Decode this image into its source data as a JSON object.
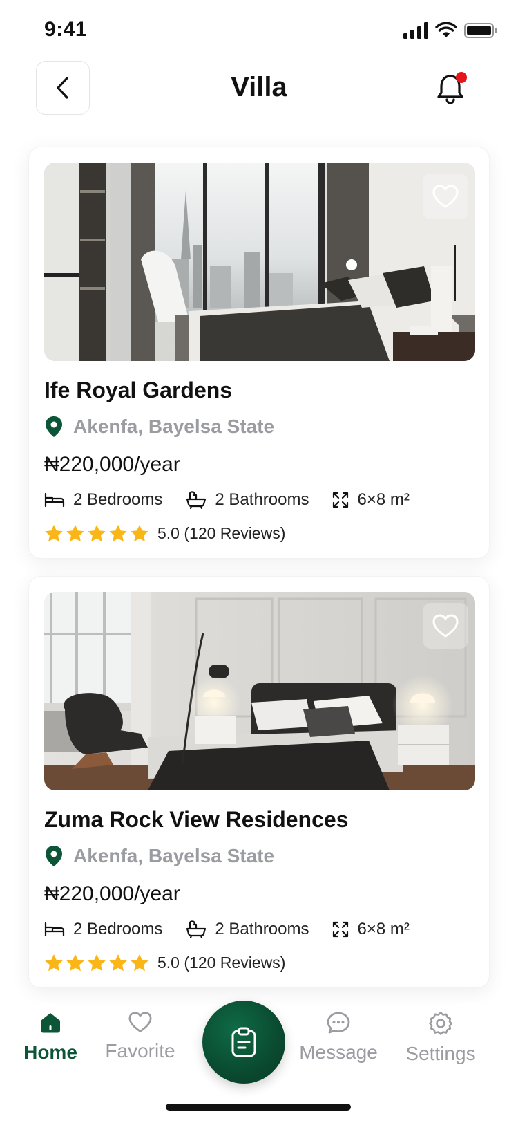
{
  "status_bar": {
    "time": "9:41"
  },
  "header": {
    "title": "Villa",
    "back_icon": "chevron-left-icon",
    "notification_icon": "bell-icon"
  },
  "colors": {
    "accent": "#0c5537",
    "star": "#f9b616",
    "muted": "#9b9ca1",
    "notification_dot": "#e8141c"
  },
  "listings": [
    {
      "name": "Ife Royal Gardens",
      "location": "Akenfa, Bayelsa State",
      "price": "₦220,000/year",
      "bedrooms": "2 Bedrooms",
      "bathrooms": "2 Bathrooms",
      "size": "6×8 m²",
      "rating": 5,
      "rating_text": "5.0 (120 Reviews)"
    },
    {
      "name": "Zuma Rock View Residences",
      "location": "Akenfa, Bayelsa State",
      "price": "₦220,000/year",
      "bedrooms": "2 Bedrooms",
      "bathrooms": "2 Bathrooms",
      "size": "6×8 m²",
      "rating": 5,
      "rating_text": "5.0 (120 Reviews)"
    }
  ],
  "bottom_nav": {
    "items": [
      {
        "label": "Home",
        "icon": "home-icon",
        "active": true
      },
      {
        "label": "Favorite",
        "icon": "heart-icon",
        "active": false
      },
      {
        "label": "Message",
        "icon": "chat-icon",
        "active": false
      },
      {
        "label": "Settings",
        "icon": "gear-icon",
        "active": false
      }
    ],
    "center_icon": "clipboard-icon"
  }
}
